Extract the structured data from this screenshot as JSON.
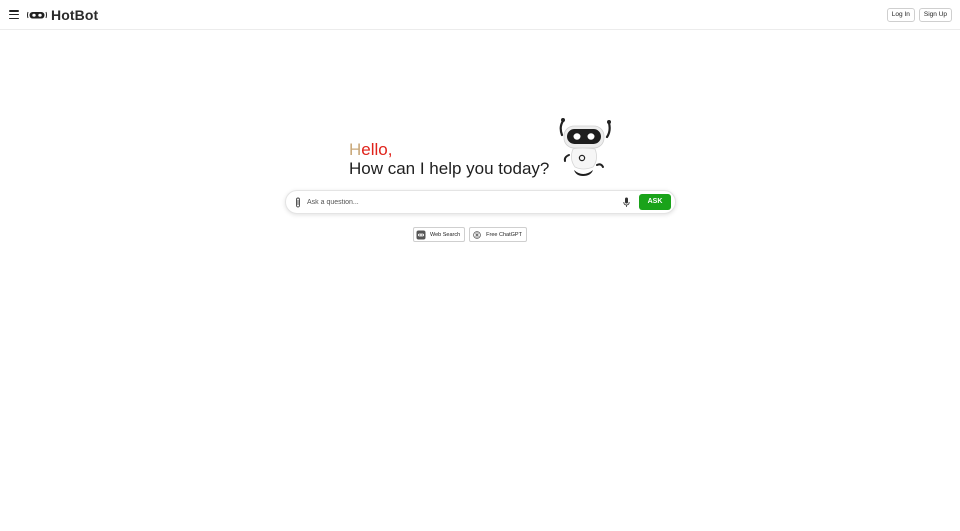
{
  "header": {
    "brand": "HotBot",
    "login_label": "Log In",
    "signup_label": "Sign Up"
  },
  "hero": {
    "hello_first": "H",
    "hello_rest": "ello,",
    "subtitle": "How can I help you today?"
  },
  "search": {
    "placeholder": "Ask a question...",
    "ask_label": "ASK"
  },
  "chips": [
    {
      "label": "Web Search",
      "icon": "web-search-icon"
    },
    {
      "label": "Free ChatGPT",
      "icon": "chatgpt-icon"
    }
  ],
  "colors": {
    "hello": "#e0231b",
    "hello_first_letter": "#c9a87a",
    "ask_button": "#1aa31a"
  }
}
